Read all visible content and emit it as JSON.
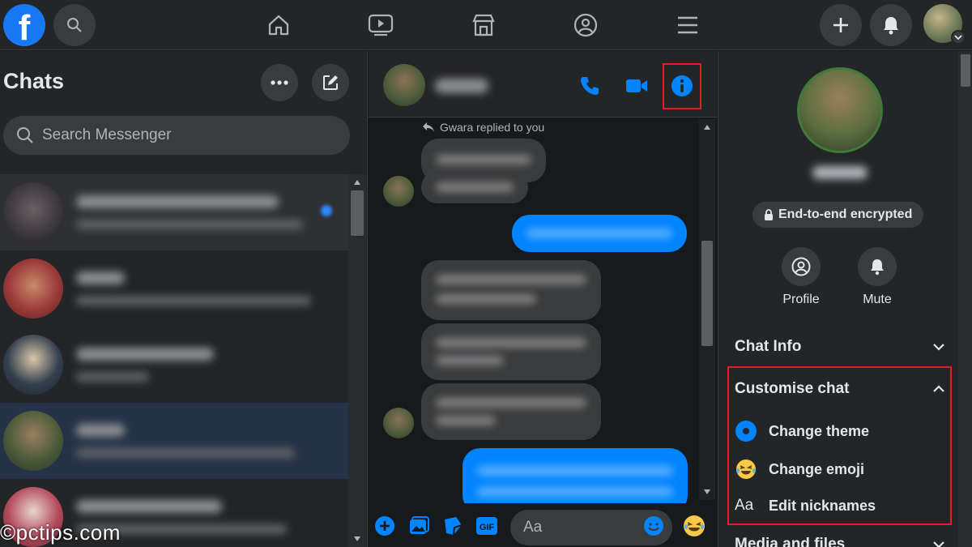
{
  "topbar": {
    "logo_letter": "f",
    "nav": [
      "home-icon",
      "watch-icon",
      "marketplace-icon",
      "groups-icon",
      "menu-icon"
    ],
    "actions": [
      "plus-icon",
      "bell-icon"
    ]
  },
  "chats": {
    "title": "Chats",
    "search_placeholder": "Search Messenger"
  },
  "conversation": {
    "replied_note": "Gwara replied to you",
    "composer_placeholder": "Aa"
  },
  "details": {
    "encryption": "End-to-end encrypted",
    "actions": [
      {
        "label": "Profile",
        "icon": "profile-icon"
      },
      {
        "label": "Mute",
        "icon": "bell-icon"
      }
    ],
    "chat_info": "Chat Info",
    "customise": {
      "title": "Customise chat",
      "items": [
        {
          "label": "Change theme",
          "icon": "theme-icon"
        },
        {
          "label": "Change emoji",
          "icon": "emoji-icon"
        },
        {
          "label": "Edit nicknames",
          "icon_text": "Aa"
        }
      ]
    },
    "media_files": "Media and files"
  },
  "watermark": "©pctips.com",
  "colors": {
    "accent": "#0084ff",
    "highlight": "#e41e26",
    "background": "#18191a",
    "panel": "#242526"
  }
}
